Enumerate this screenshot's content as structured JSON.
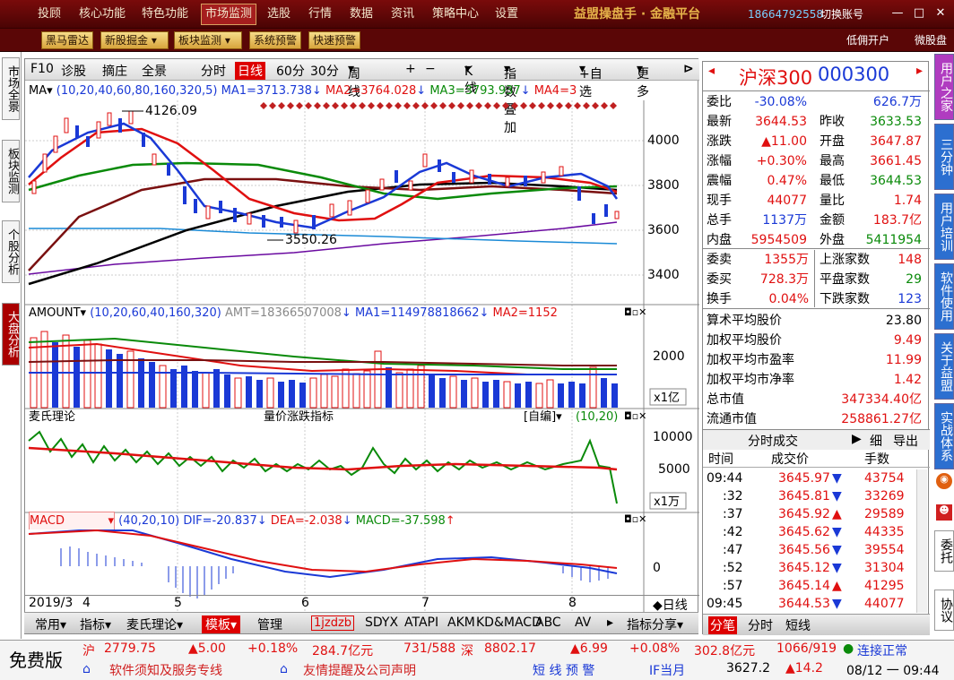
{
  "menu": {
    "items": [
      "投顾",
      "核心功能",
      "特色功能",
      "市场监测",
      "选股",
      "行情",
      "数据",
      "资讯",
      "策略中心",
      "设置"
    ],
    "brand": "益盟操盘手 · 金融平台",
    "phone": "18664792558",
    "switch_account": "切换账号"
  },
  "toolbar": {
    "buttons": [
      "黑马雷达",
      "新股掘金",
      "板块监测",
      "系统预警",
      "快速预警"
    ],
    "right": [
      "低佣开户",
      "微股盘"
    ]
  },
  "left_tabs": [
    "市场全景",
    "板块监测",
    "个股分析",
    "大盘分析"
  ],
  "chart_toolbar": {
    "items": [
      "F10",
      "诊股",
      "摘庄",
      "全景",
      "分时",
      "日线",
      "60分",
      "30分",
      "周线",
      "+",
      "−",
      "K线",
      "指数叠加",
      "+自选",
      "更多"
    ]
  },
  "ma_line": {
    "label": "MA",
    "params": "(10,20,40,60,80,160,320,5)",
    "ma1": "MA1=3713.738",
    "ma2": "MA2=3764.028",
    "ma3": "MA3=3793.937",
    "ma4": "MA4=3"
  },
  "price_axis": [
    "4000",
    "3800",
    "3600",
    "3400"
  ],
  "annot": {
    "high": "4126.09",
    "low": "3550.26"
  },
  "amount_line": {
    "label": "AMOUNT",
    "params": "(10,20,60,40,160,320)",
    "amt": "AMT=18366507008",
    "ma1": "MA1=114978818662",
    "ma2": "MA2=1152"
  },
  "amount_axis": {
    "v": "2000",
    "unit": "x1亿"
  },
  "mai_line": {
    "title": "麦氏理论",
    "sub": "量价涨跌指标",
    "mode": "[自编]",
    "params": "(10,20)"
  },
  "mai_axis": {
    "a": "10000",
    "b": "5000",
    "unit": "x1万"
  },
  "macd_line": {
    "label": "MACD",
    "params": "(40,20,10)",
    "dif": "DIF=-20.837",
    "dea": "DEA=-2.038",
    "macd": "MACD=-37.598"
  },
  "macd_axis": "0",
  "date_axis": {
    "d0": "2019/3",
    "d1": "4",
    "d2": "5",
    "d3": "6",
    "d4": "7",
    "d5": "8",
    "mode": "◆日线"
  },
  "bottom_tabs": [
    "常用",
    "指标",
    "麦氏理论",
    "模板",
    "管理",
    "1jzdzb",
    "SDYX",
    "ATAPI",
    "AKM",
    "KD&MACD",
    "ABC",
    "AV",
    "指标分享"
  ],
  "quote": {
    "name": "沪深300",
    "code": "000300",
    "rows": [
      [
        "委比",
        "-30.08%",
        "",
        "626.7万"
      ],
      [
        "最新",
        "3644.53",
        "昨收",
        "3633.53"
      ],
      [
        "涨跌",
        "▲11.00",
        "开盘",
        "3647.87"
      ],
      [
        "涨幅",
        "+0.30%",
        "最高",
        "3661.45"
      ],
      [
        "震幅",
        "0.47%",
        "最低",
        "3644.53"
      ],
      [
        "现手",
        "44077",
        "量比",
        "1.74"
      ],
      [
        "总手",
        "1137万",
        "金额",
        "183.7亿"
      ],
      [
        "内盘",
        "5954509",
        "外盘",
        "5411954"
      ],
      [
        "委卖",
        "1355万",
        "上涨家数",
        "148"
      ],
      [
        "委买",
        "728.3万",
        "平盘家数",
        "29"
      ],
      [
        "换手",
        "0.04%",
        "下跌家数",
        "123"
      ]
    ],
    "stats": [
      [
        "算术平均股价",
        "23.80"
      ],
      [
        "加权平均股价",
        "9.49"
      ],
      [
        "加权平均市盈率",
        "11.99"
      ],
      [
        "加权平均市净率",
        "1.42"
      ],
      [
        "总市值",
        "347334.40亿"
      ],
      [
        "流通市值",
        "258861.27亿"
      ]
    ],
    "trade_header": {
      "title": "分时成交",
      "a": "细",
      "b": "导出"
    },
    "trade_cols": [
      "时间",
      "成交价",
      "手数"
    ],
    "trades": [
      [
        "09:44",
        "3645.97",
        "▼",
        "43754"
      ],
      [
        ":32",
        "3645.81",
        "▼",
        "33269"
      ],
      [
        ":37",
        "3645.92",
        "▲",
        "29589"
      ],
      [
        ":42",
        "3645.62",
        "▼",
        "44335"
      ],
      [
        ":47",
        "3645.56",
        "▼",
        "39554"
      ],
      [
        ":52",
        "3645.12",
        "▼",
        "31304"
      ],
      [
        ":57",
        "3645.14",
        "▲",
        "41295"
      ],
      [
        "09:45",
        "3644.53",
        "▼",
        "44077"
      ]
    ],
    "tabs": [
      "分笔",
      "分时",
      "短线"
    ]
  },
  "right_tabs": [
    "用户之家",
    "三分钟",
    "用户培训",
    "软件使用",
    "关于益盟",
    "实战体系",
    "委托",
    "协议"
  ],
  "status": {
    "free": "免费版",
    "sh_label": "沪",
    "sh_val": "2779.75",
    "sh_chg": "▲5.00",
    "sh_pct": "+0.18%",
    "sh_amt": "284.7亿元",
    "sh_ratio": "731/588",
    "sz_label": "深",
    "sz_val": "8802.17",
    "sz_chg": "▲6.99",
    "sz_pct": "+0.08%",
    "sz_amt": "302.8亿元",
    "sz_ratio": "1066/919",
    "conn": "连接正常",
    "notice1": "软件须知及服务专线",
    "notice2": "友情提醒及公司声明",
    "shortwarn": "短 线 预 警",
    "if_label": "IF当月",
    "if_val": "3627.2",
    "if_chg": "▲14.2",
    "datetime": "08/12 一 09:44"
  }
}
